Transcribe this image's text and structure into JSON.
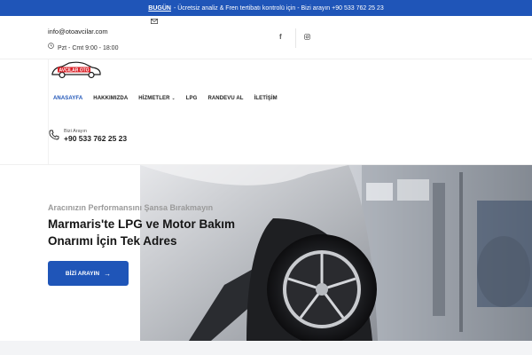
{
  "topbar": {
    "highlight": "BUGÜN",
    "message": "- Ücretsiz analiz & Fren tertibatı kontrolü için - Bizi arayın +90 533 762 25 23",
    "bg_color": "#1f55b8"
  },
  "contact": {
    "email": "info@otoavcilar.com",
    "hours": "Pzt - Cmt 9:00 - 18:00"
  },
  "social": {
    "facebook_icon": "facebook-icon",
    "instagram_icon": "instagram-icon"
  },
  "logo": {
    "text": "AVCILAR OTO"
  },
  "nav": {
    "items": [
      {
        "label": "ANASAYFA"
      },
      {
        "label": "HAKKIMIZDA"
      },
      {
        "label": "HİZMETLER"
      },
      {
        "label": "LPG"
      },
      {
        "label": "RANDEVU AL"
      },
      {
        "label": "İLETİŞİM"
      }
    ],
    "active_color": "#1f55b8"
  },
  "call": {
    "label": "Bizi Arayın",
    "number": "+90 533 762 25 23"
  },
  "hero": {
    "subtitle": "Aracınızın Performansını Şansa Bırakmayın",
    "title": "Marmaris'te LPG ve Motor Bakım Onarımı İçin Tek Adres",
    "cta_label": "BİZİ ARAYIN"
  }
}
